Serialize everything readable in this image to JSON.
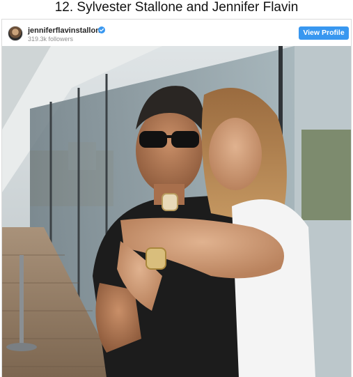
{
  "article": {
    "heading": "12. Sylvester Stallone and Jennifer Flavin"
  },
  "embed": {
    "username": "jenniferflavinstallone",
    "followers": "319.3k followers",
    "view_profile_label": "View Profile",
    "verified": true,
    "avatar_icon": "profile-avatar",
    "verified_icon": "verified-badge-icon",
    "accent_color": "#3897f0",
    "photo_alt": "Sylvester Stallone and Jennifer Flavin"
  }
}
